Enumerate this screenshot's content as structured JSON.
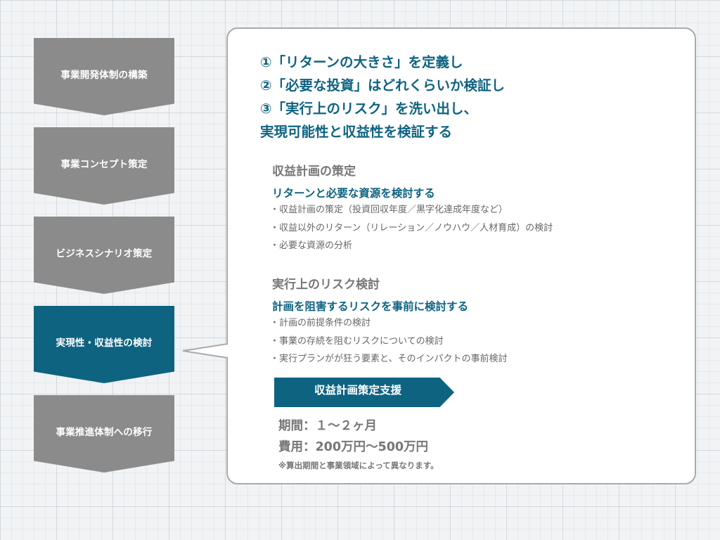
{
  "steps": [
    {
      "label": "事業開発体制の構築",
      "active": false
    },
    {
      "label": "事業コンセプト策定",
      "active": false
    },
    {
      "label": "ビジネスシナリオ策定",
      "active": false
    },
    {
      "label": "実現性・収益性の検討",
      "active": true
    },
    {
      "label": "事業推進体制への移行",
      "active": false
    }
  ],
  "headline": [
    "①「リターンの大きさ」を定義し",
    "②「必要な投資」はどれくらいか検証し",
    "③「実行上のリスク」を洗い出し、",
    "実現可能性と収益性を検証する"
  ],
  "sections": [
    {
      "title": "収益計画の策定",
      "subtitle": "リターンと必要な資源を検討する",
      "bullets": [
        "・収益計画の策定（投資回収年度／黒字化達成年度など）",
        "・収益以外のリターン（リレーション／ノウハウ／人材育成）の検討",
        "・必要な資源の分析"
      ]
    },
    {
      "title": "実行上のリスク検討",
      "subtitle": "計画を阻害するリスクを事前に検討する",
      "bullets": [
        "・計画の前提条件の検討",
        "・事業の存続を阻むリスクについての検討",
        "・実行プランがが狂う要素と、そのインパクトの事前検討"
      ]
    }
  ],
  "service": {
    "banner": "収益計画策定支援",
    "period": "期間：１～２ヶ月",
    "cost": "費用：200万円～500万円",
    "note": "※算出期間と事業領域によって異なります。"
  },
  "colors": {
    "accent": "#0e6381",
    "step_gray": "#8b8b8b",
    "text_gray": "#777777"
  }
}
